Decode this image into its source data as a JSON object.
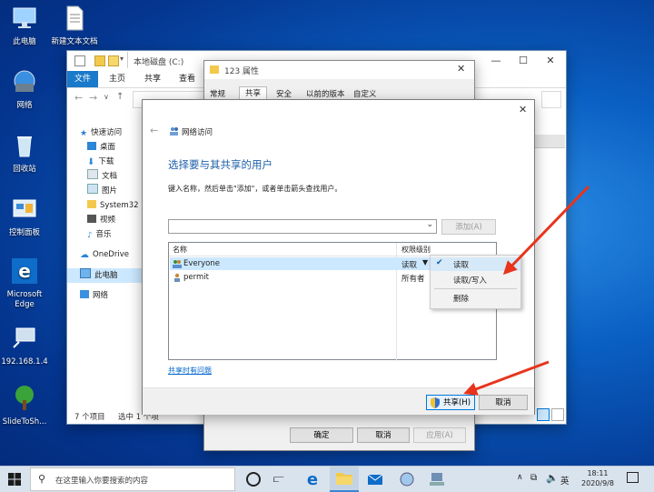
{
  "desktop": {
    "icons": [
      {
        "label": "此电脑"
      },
      {
        "label": "新建文本文档"
      },
      {
        "label": "网络"
      },
      {
        "label": "回收站"
      },
      {
        "label": "控制面板"
      },
      {
        "label": "Microsoft Edge"
      },
      {
        "label": "192.168.1.4"
      },
      {
        "label": "SlideToSh..."
      }
    ]
  },
  "explorer": {
    "title": "本地磁盘 (C:)",
    "ribbon_tabs": [
      "文件",
      "主页",
      "共享",
      "查看"
    ],
    "nav": [
      "快速访问",
      "桌面",
      "下载",
      "文档",
      "图片",
      "System32",
      "视频",
      "音乐",
      "OneDrive",
      "此电脑",
      "网络"
    ],
    "status": {
      "count": "7 个项目",
      "selected": "选中 1 个项"
    }
  },
  "properties": {
    "title": "123 属性",
    "tabs": [
      "常规",
      "共享",
      "安全",
      "以前的版本",
      "自定义"
    ],
    "buttons": {
      "ok": "确定",
      "cancel": "取消",
      "apply": "应用(A)"
    }
  },
  "share_dialog": {
    "crumb": "网络访问",
    "heading": "选择要与其共享的用户",
    "instruction": "键入名称，然后单击\"添加\"，或者单击箭头查找用户。",
    "input_value": "",
    "add_button": "添加(A)",
    "columns": {
      "name": "名称",
      "level": "权限级别"
    },
    "rows": [
      {
        "name": "Everyone",
        "level": "读取"
      },
      {
        "name": "permit",
        "level": "所有者"
      }
    ],
    "menu": [
      {
        "label": "读取",
        "checked": true
      },
      {
        "label": "读取/写入",
        "checked": false
      },
      {
        "label": "删除",
        "checked": false
      }
    ],
    "help_link": "共享时有问题",
    "share_button": "共享(H)",
    "cancel_button": "取消"
  },
  "taskbar": {
    "search_placeholder": "在这里输入你要搜索的内容",
    "tray": {
      "ime": "英",
      "time": "18:11",
      "date": "2020/9/8"
    }
  },
  "colors": {
    "accent": "#0078d7",
    "heading": "#1e5fa8",
    "arrow": "#e8341c",
    "selection": "#cce8ff"
  }
}
